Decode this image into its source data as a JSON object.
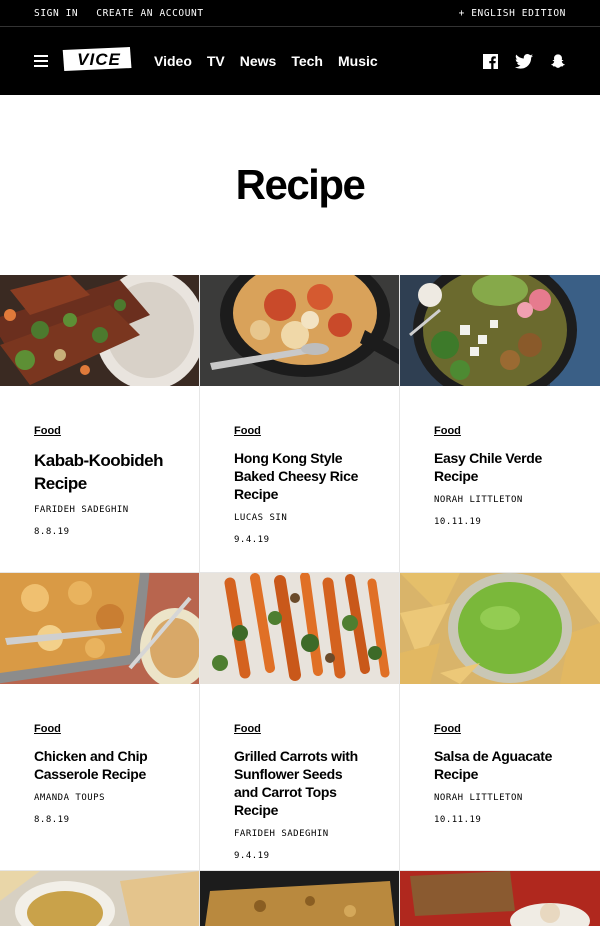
{
  "topbar": {
    "sign_in": "SIGN IN",
    "create_account": "CREATE AN ACCOUNT",
    "edition": "+ ENGLISH EDITION"
  },
  "nav": {
    "logo": "VICE",
    "items": [
      "Video",
      "TV",
      "News",
      "Tech",
      "Music"
    ],
    "social_icons": [
      "facebook-icon",
      "twitter-icon",
      "snapchat-icon"
    ]
  },
  "page": {
    "title": "Recipe"
  },
  "cards": [
    {
      "category": "Food",
      "title": "Kabab-Koobideh Recipe",
      "author": "FARIDEH SADEGHIN",
      "date": "8.8.19"
    },
    {
      "category": "Food",
      "title": "Hong Kong Style Baked Cheesy Rice Recipe",
      "author": "LUCAS SIN",
      "date": "9.4.19"
    },
    {
      "category": "Food",
      "title": "Easy Chile Verde Recipe",
      "author": "NORAH LITTLETON",
      "date": "10.11.19"
    },
    {
      "category": "Food",
      "title": "Chicken and Chip Casserole Recipe",
      "author": "AMANDA TOUPS",
      "date": "8.8.19"
    },
    {
      "category": "Food",
      "title": "Grilled Carrots with Sunflower Seeds and Carrot Tops Recipe",
      "author": "FARIDEH SADEGHIN",
      "date": "9.4.19"
    },
    {
      "category": "Food",
      "title": "Salsa de Aguacate Recipe",
      "author": "NORAH LITTLETON",
      "date": "10.11.19"
    }
  ],
  "colors": {
    "background": "#ffffff",
    "header": "#000000",
    "divider": "#e6e6e6"
  }
}
